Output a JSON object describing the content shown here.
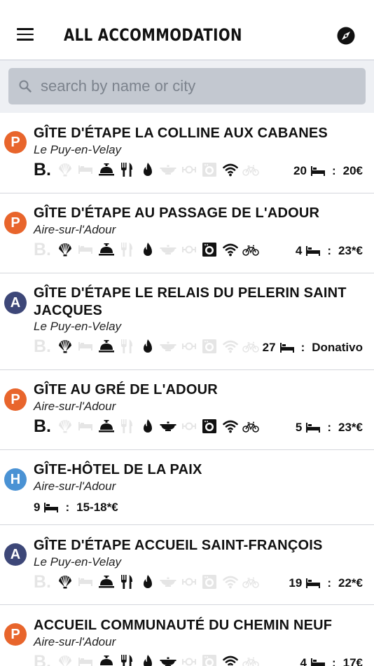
{
  "header": {
    "title": "ALL ACCOMMODATION",
    "menu_icon": "menu-icon",
    "compass_icon": "compass-icon"
  },
  "search": {
    "placeholder": "search by name or city",
    "value": ""
  },
  "colors": {
    "P": "#e8652c",
    "A": "#3d4778",
    "H": "#4a92d4"
  },
  "items": [
    {
      "badge": "P",
      "name": "GÎTE D'ÉTAPE LA COLLINE AUX CABANES",
      "city": "Le Puy-en-Velay",
      "features": {
        "breakfast": true,
        "shell": false,
        "bed": false,
        "reception": true,
        "restaurant": true,
        "kitchen": true,
        "meals": false,
        "camping": false,
        "washer": false,
        "wifi": true,
        "bike": false
      },
      "beds": "20",
      "price": "20€"
    },
    {
      "badge": "P",
      "name": "GÎTE D'ÉTAPE AU PASSAGE DE L'ADOUR",
      "city": "Aire-sur-l'Adour",
      "features": {
        "breakfast": false,
        "shell": true,
        "bed": false,
        "reception": true,
        "restaurant": false,
        "kitchen": true,
        "meals": false,
        "camping": false,
        "washer": true,
        "wifi": true,
        "bike": true
      },
      "beds": "4",
      "price": "23*€"
    },
    {
      "badge": "A",
      "name": "GÎTE D'ÉTAPE LE RELAIS DU PELERIN SAINT JACQUES",
      "city": "Le Puy-en-Velay",
      "features": {
        "breakfast": false,
        "shell": true,
        "bed": false,
        "reception": true,
        "restaurant": false,
        "kitchen": true,
        "meals": false,
        "camping": false,
        "washer": false,
        "wifi": false,
        "bike": false
      },
      "beds": "27",
      "price": "Donativo"
    },
    {
      "badge": "P",
      "name": "GÎTE AU GRÉ DE L'ADOUR",
      "city": "Aire-sur-l'Adour",
      "features": {
        "breakfast": true,
        "shell": false,
        "bed": false,
        "reception": true,
        "restaurant": false,
        "kitchen": true,
        "meals": true,
        "camping": false,
        "washer": true,
        "wifi": true,
        "bike": true
      },
      "beds": "5",
      "price": "23*€"
    },
    {
      "badge": "H",
      "name": "GÎTE-HÔTEL DE LA PAIX",
      "city": "Aire-sur-l'Adour",
      "features": null,
      "beds": "9",
      "price": "15-18*€"
    },
    {
      "badge": "A",
      "name": "GÎTE D'ÉTAPE ACCUEIL SAINT-FRANÇOIS",
      "city": "Le Puy-en-Velay",
      "features": {
        "breakfast": false,
        "shell": true,
        "bed": false,
        "reception": true,
        "restaurant": true,
        "kitchen": true,
        "meals": false,
        "camping": false,
        "washer": false,
        "wifi": false,
        "bike": false
      },
      "beds": "19",
      "price": "22*€"
    },
    {
      "badge": "P",
      "name": "ACCUEIL COMMUNAUTÉ DU CHEMIN NEUF",
      "city": "Aire-sur-l'Adour",
      "features": {
        "breakfast": false,
        "shell": false,
        "bed": false,
        "reception": true,
        "restaurant": true,
        "kitchen": true,
        "meals": true,
        "camping": false,
        "washer": false,
        "wifi": true,
        "bike": false
      },
      "beds": "4",
      "price": "17€"
    }
  ]
}
